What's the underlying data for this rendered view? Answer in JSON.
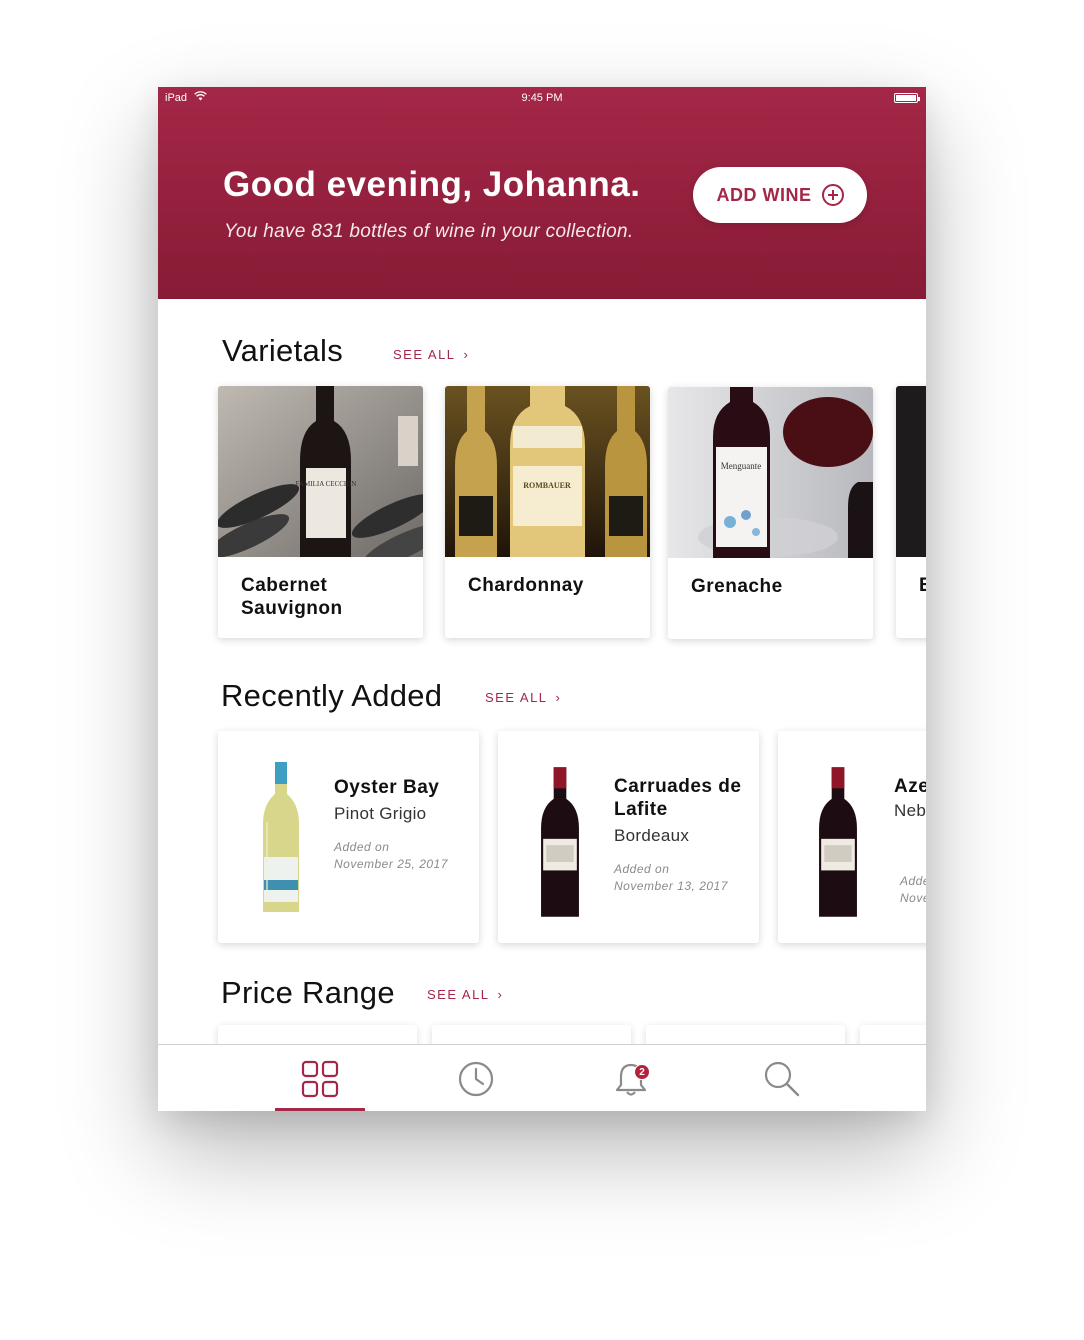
{
  "status_bar": {
    "carrier": "iPad",
    "time": "9:45 PM"
  },
  "header": {
    "greeting": "Good evening, Johanna.",
    "subtitle": "You have 831 bottles of wine in your collection.",
    "add_button_label": "ADD WINE"
  },
  "varietals": {
    "title": "Varietals",
    "see_all": "SEE ALL",
    "items": [
      {
        "label": "Cabernet Sauvignon",
        "bottle_text": "FAMILIA CECCHIN"
      },
      {
        "label": "Chardonnay",
        "bottle_text": "ROMBAUER"
      },
      {
        "label": "Grenache",
        "bottle_text": "Menguante"
      },
      {
        "label": "B"
      }
    ]
  },
  "recently_added": {
    "title": "Recently Added",
    "see_all": "SEE ALL",
    "items": [
      {
        "name": "Oyster Bay",
        "type": "Pinot Grigio",
        "added_label": "Added on",
        "added_date": "November 25, 2017"
      },
      {
        "name": "Carruades de Lafite",
        "type": "Bordeaux",
        "added_label": "Added on",
        "added_date": "November 13, 2017"
      },
      {
        "name": "Aze",
        "type": "Neb",
        "added_label": "Adde",
        "added_date": "Nove"
      }
    ]
  },
  "price_range": {
    "title": "Price Range",
    "see_all": "SEE ALL"
  },
  "tabbar": {
    "notification_count": "2"
  },
  "colors": {
    "brand": "#a42747",
    "brand_dark": "#871b35"
  }
}
